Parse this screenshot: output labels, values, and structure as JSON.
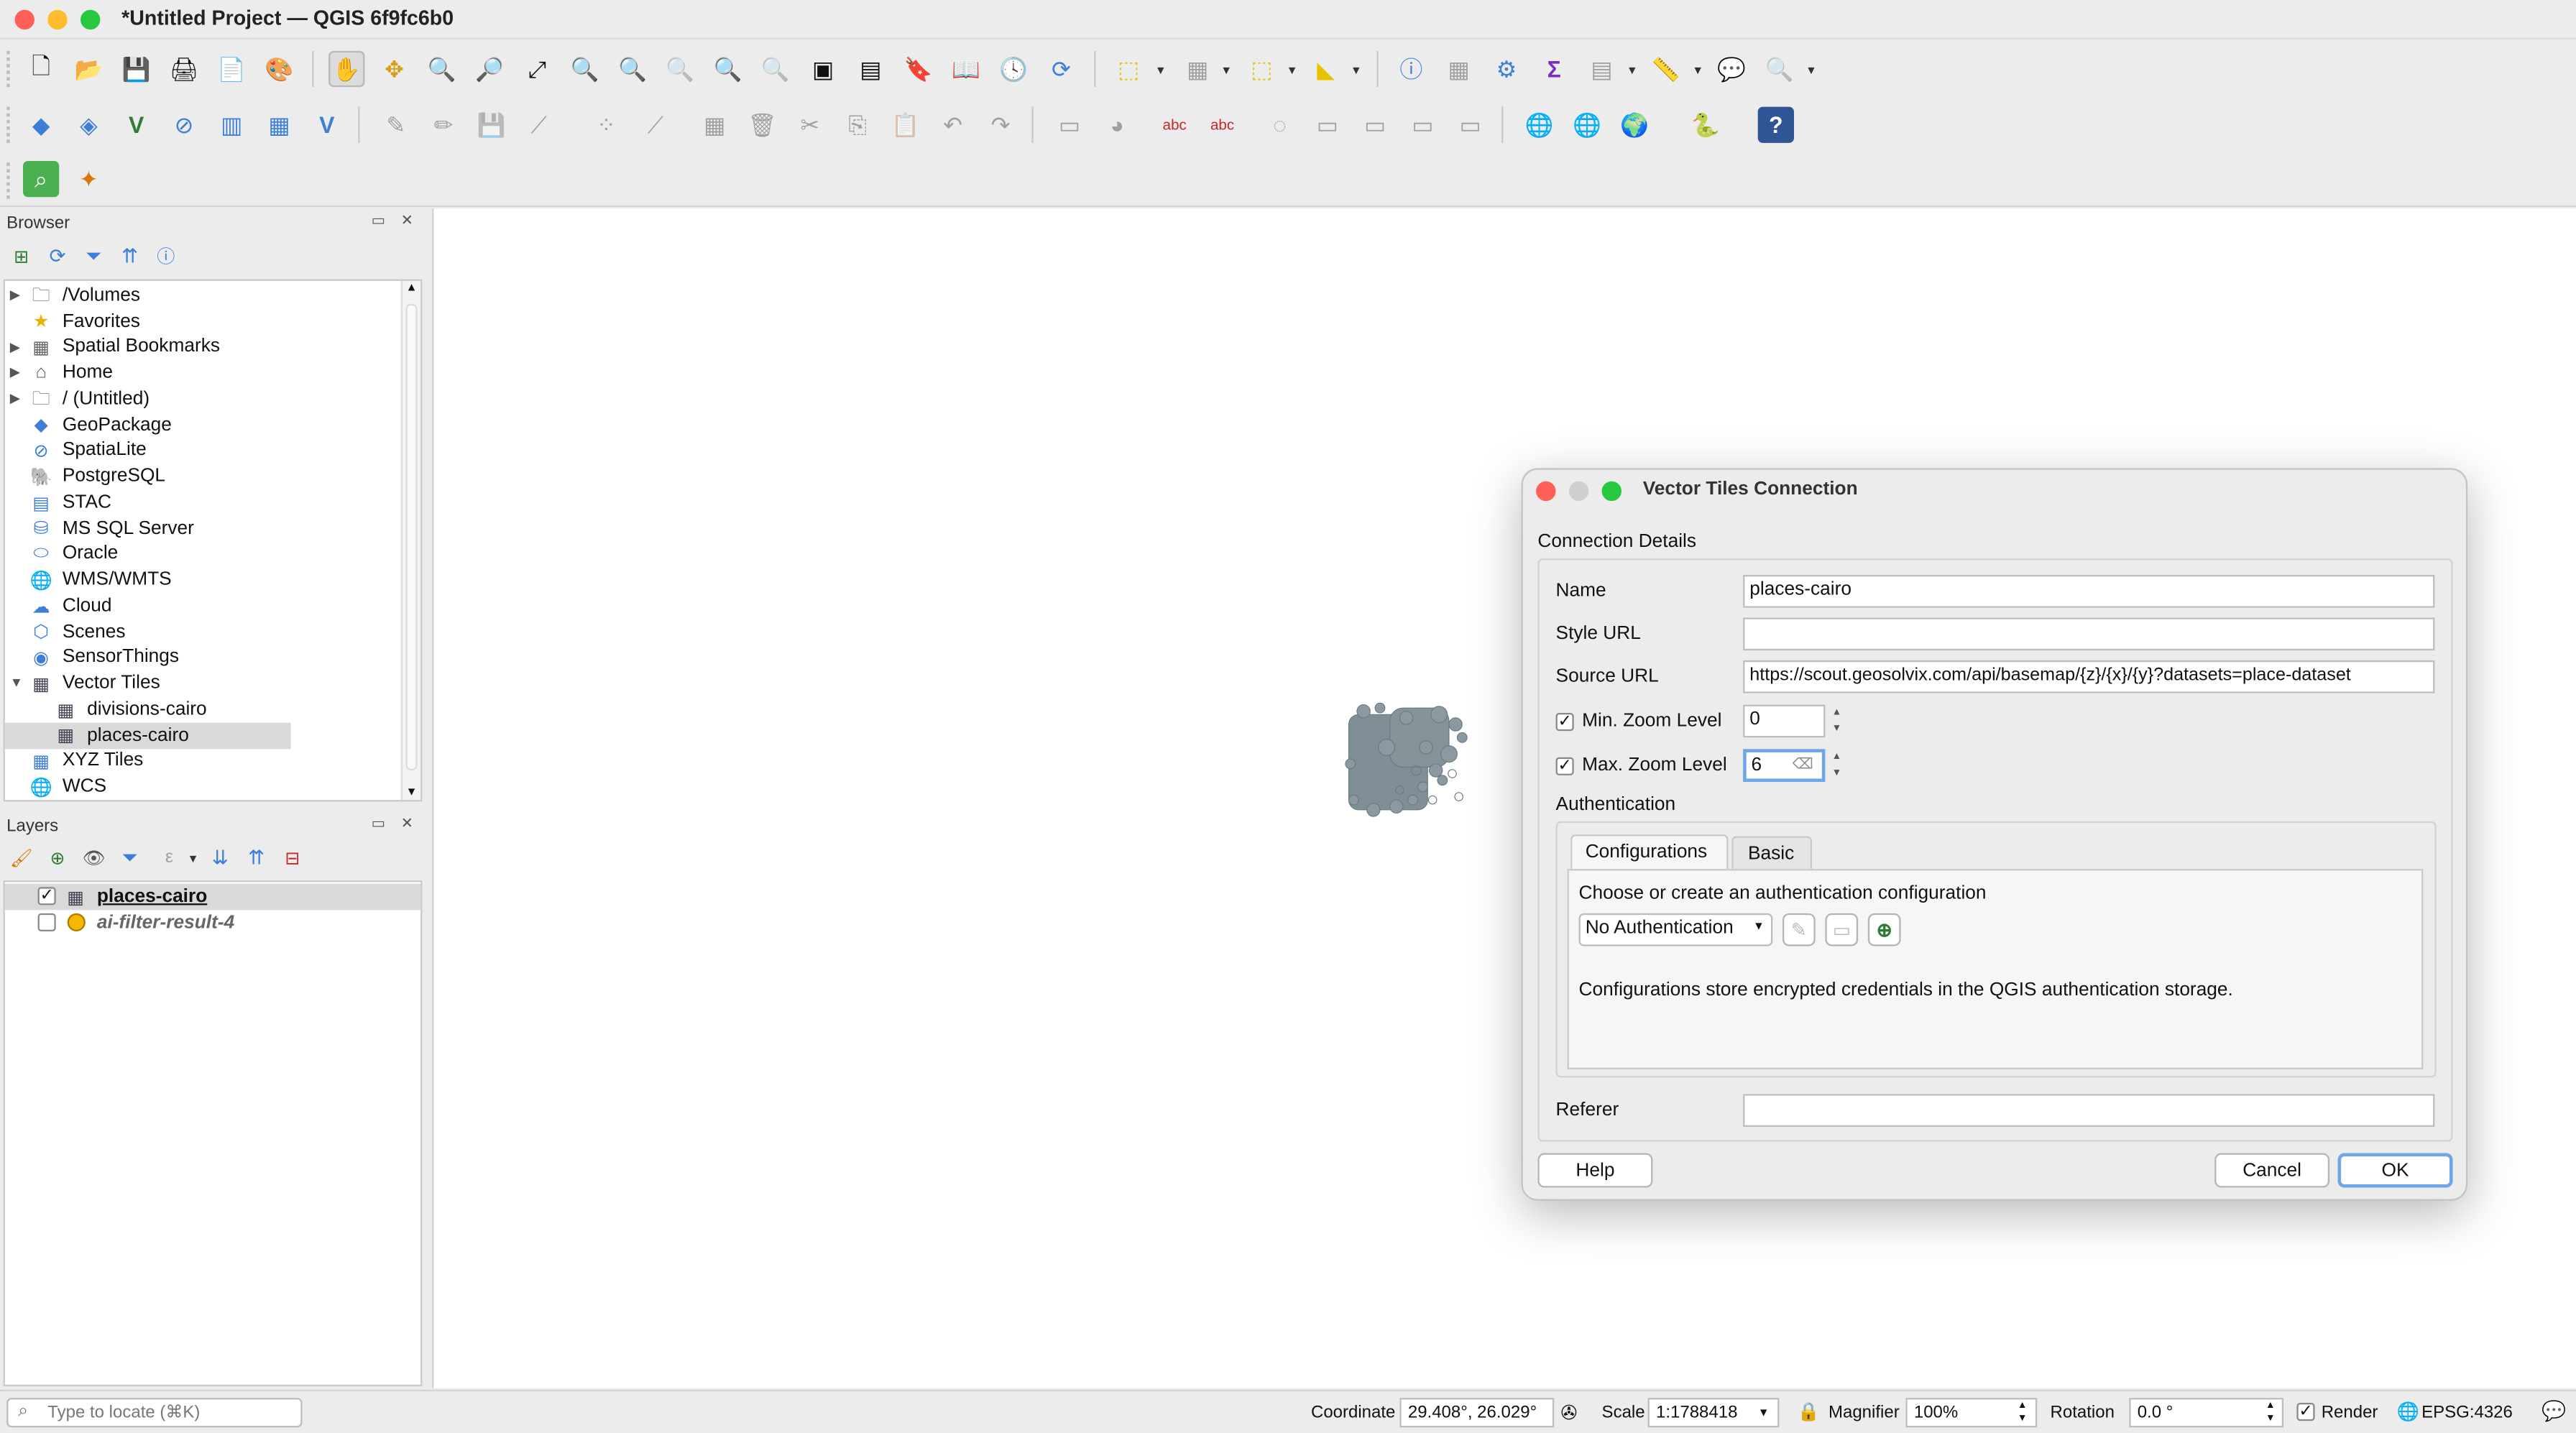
{
  "window": {
    "title": "*Untitled Project — QGIS 6f9fc6b0"
  },
  "colors": {
    "close": "#fe5f57",
    "minimize": "#febc2e",
    "zoom": "#28c840",
    "selection": "#d9d9d9",
    "accent": "#3d7fd8"
  },
  "browser": {
    "title": "Browser",
    "items": [
      {
        "label": "/Volumes",
        "icon": "folder-icon"
      },
      {
        "label": "Favorites",
        "icon": "star-icon"
      },
      {
        "label": "Spatial Bookmarks",
        "icon": "bookmark-icon"
      },
      {
        "label": "Home",
        "icon": "home-icon"
      },
      {
        "label": "/ (Untitled)",
        "icon": "folder-icon"
      },
      {
        "label": "GeoPackage",
        "icon": "geopackage-icon"
      },
      {
        "label": "SpatiaLite",
        "icon": "spatialite-icon"
      },
      {
        "label": "PostgreSQL",
        "icon": "postgresql-icon"
      },
      {
        "label": "STAC",
        "icon": "stac-icon"
      },
      {
        "label": "MS SQL Server",
        "icon": "mssql-icon"
      },
      {
        "label": "Oracle",
        "icon": "oracle-icon"
      },
      {
        "label": "WMS/WMTS",
        "icon": "wms-icon"
      },
      {
        "label": "Cloud",
        "icon": "cloud-icon"
      },
      {
        "label": "Scenes",
        "icon": "scenes-icon"
      },
      {
        "label": "SensorThings",
        "icon": "sensorthings-icon"
      },
      {
        "label": "Vector Tiles",
        "icon": "vector-tiles-icon"
      },
      {
        "label": "divisions-cairo",
        "icon": "vector-tiles-icon"
      },
      {
        "label": "places-cairo",
        "icon": "vector-tiles-icon"
      },
      {
        "label": "XYZ Tiles",
        "icon": "xyz-tiles-icon"
      },
      {
        "label": "WCS",
        "icon": "wcs-icon"
      }
    ]
  },
  "layers": {
    "title": "Layers",
    "items": [
      {
        "label": "places-cairo",
        "checked": true
      },
      {
        "label": "ai-filter-result-4",
        "checked": false
      }
    ]
  },
  "dialog": {
    "title": "Vector Tiles Connection",
    "section": "Connection Details",
    "name_label": "Name",
    "name_value": "places-cairo",
    "style_url_label": "Style URL",
    "style_url_value": "",
    "source_url_label": "Source URL",
    "source_url_value": "https://scout.geosolvix.com/api/basemap/{z}/{x}/{y}?datasets=place-dataset",
    "min_zoom_label": "Min. Zoom Level",
    "min_zoom_value": "0",
    "max_zoom_label": "Max. Zoom Level",
    "max_zoom_value": "6",
    "auth_label": "Authentication",
    "tab_configurations": "Configurations",
    "tab_basic": "Basic",
    "auth_prompt": "Choose or create an authentication configuration",
    "auth_select": "No Authentication",
    "auth_note": "Configurations store encrypted credentials in the QGIS authentication storage.",
    "referer_label": "Referer",
    "referer_value": "",
    "help": "Help",
    "cancel": "Cancel",
    "ok": "OK"
  },
  "status": {
    "locate_placeholder": "Type to locate (⌘K)",
    "coordinate_label": "Coordinate",
    "coordinate_value": "29.408°, 26.029°",
    "scale_label": "Scale",
    "scale_value": "1:1788418",
    "magnifier_label": "Magnifier",
    "magnifier_value": "100%",
    "rotation_label": "Rotation",
    "rotation_value": "0.0 °",
    "render_label": "Render",
    "crs": "EPSG:4326"
  }
}
